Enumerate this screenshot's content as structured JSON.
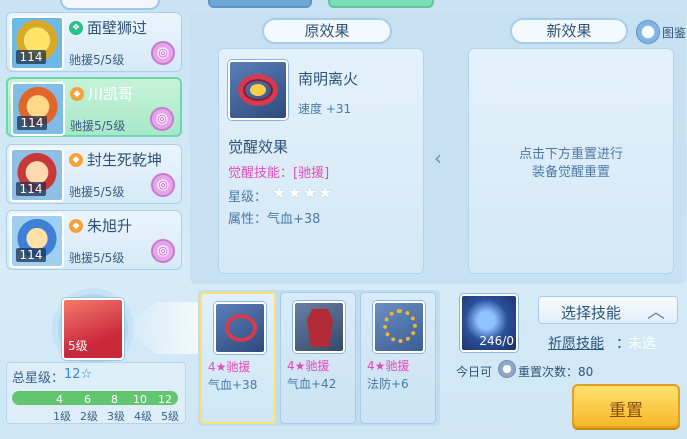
{
  "characters": [
    {
      "name": "面壁狮过",
      "level": "114",
      "assist": "驰援5/5级",
      "badge": "❖"
    },
    {
      "name": "川凯哥",
      "level": "114",
      "assist": "驰援5/5级",
      "badge": "◆"
    },
    {
      "name": "封生死乾坤",
      "level": "114",
      "assist": "驰援5/5级",
      "badge": "◆"
    },
    {
      "name": "朱旭升",
      "level": "114",
      "assist": "驰援5/5级",
      "badge": "◆"
    }
  ],
  "awaken_slot": {
    "level_label": "5级"
  },
  "star_summary": {
    "title": "总星级",
    "value": "12",
    "ticks": [
      "4",
      "6",
      "8",
      "10",
      "12"
    ],
    "levels": [
      "1级",
      "2级",
      "3级",
      "4级",
      "5级"
    ],
    "progress": 1.0
  },
  "original": {
    "header": "原效果",
    "item_name": "南明离火",
    "item_stat": "速度 +31",
    "awaken_title": "觉醒效果",
    "awaken_skill": "觉醒技能：[驰援]",
    "star_label": "星级：",
    "stars": "★★★★",
    "attr": "属性：气血+38"
  },
  "new_effect": {
    "header": "新效果",
    "hint_line1": "点击下方重置进行",
    "hint_line2": "装备觉醒重置"
  },
  "guide": {
    "label": "图鉴"
  },
  "items": [
    {
      "tag": "4★驰援",
      "stat": "气血+38"
    },
    {
      "tag": "4★驰援",
      "stat": "气血+42"
    },
    {
      "tag": "4★驰援",
      "stat": "法防+6"
    }
  ],
  "orb": {
    "count": "246/0"
  },
  "select_skill": {
    "label": "选择技能",
    "caret": "︿"
  },
  "wish": {
    "label": "祈愿技能",
    "sep": "：",
    "value": "未选"
  },
  "today": {
    "label": "今日可",
    "count": "重置次数：80"
  },
  "reset_button": {
    "label": "重置"
  }
}
